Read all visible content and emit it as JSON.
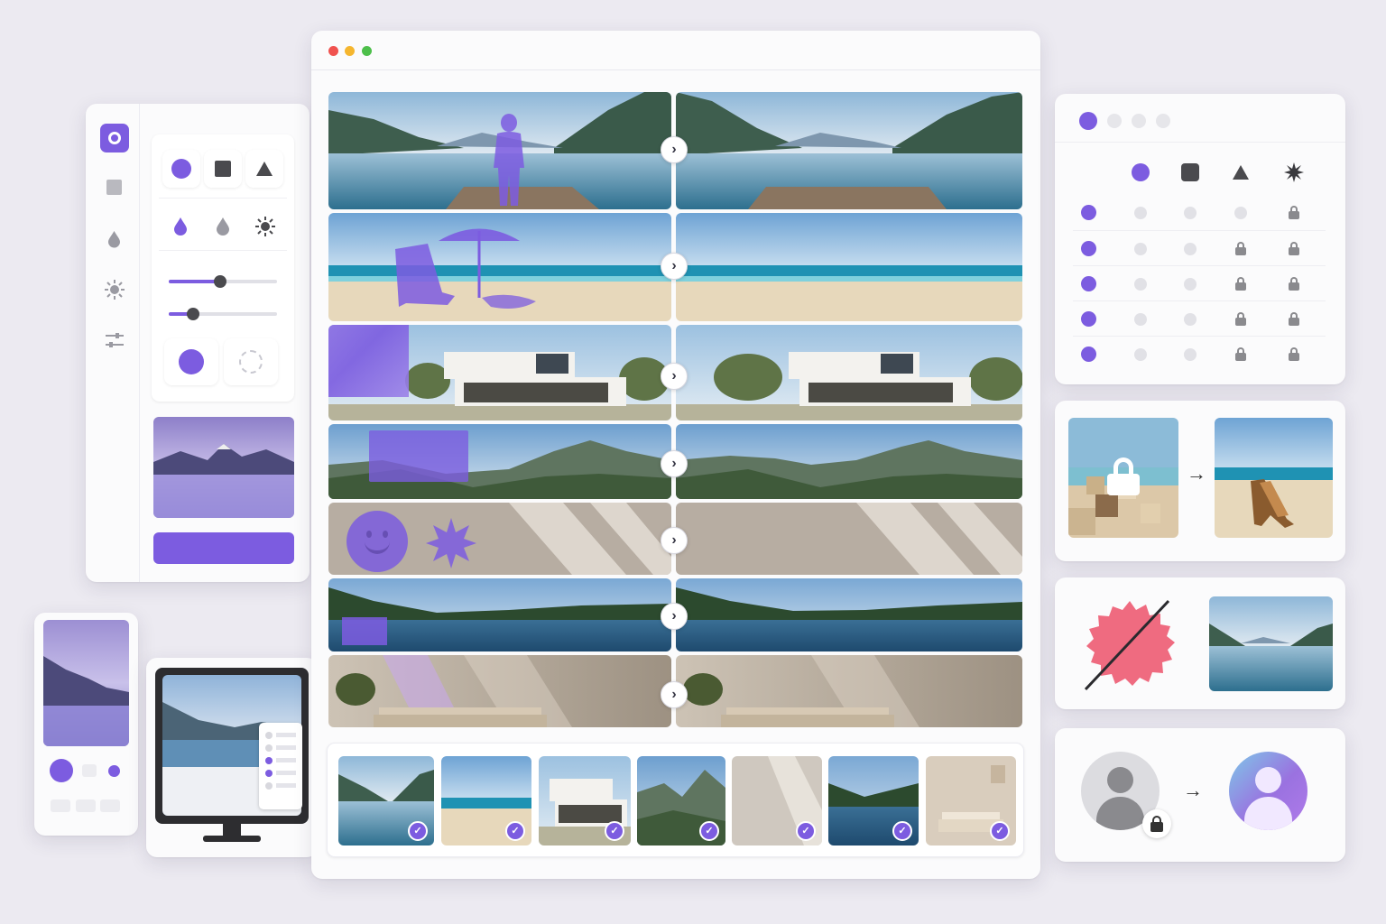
{
  "window": {
    "traffic_lights": [
      "#f0524f",
      "#f5b62f",
      "#4dbf4b"
    ]
  },
  "colors": {
    "accent": "#7c5ce0",
    "accent_light": "#a690f0",
    "coral": "#ef6b80",
    "gray": "#8a8a8a"
  },
  "tools": {
    "left_rail_icons": [
      "square-ring-icon",
      "square-icon",
      "drop-icon",
      "sun-icon",
      "sliders-icon"
    ],
    "shape_icons": [
      "circle-icon",
      "square-icon",
      "triangle-icon"
    ],
    "effect_icons": [
      "drop-icon",
      "drop-icon",
      "sun-icon"
    ],
    "sliders": [
      0.47,
      0.2
    ]
  },
  "comparisons": [
    {
      "scene": "lake-dock",
      "overlay": "person-silhouette"
    },
    {
      "scene": "beach",
      "overlay": "beach-chair-umbrella"
    },
    {
      "scene": "modern-house",
      "overlay": "pixelated-block"
    },
    {
      "scene": "mountain-valley",
      "overlay": "rectangle"
    },
    {
      "scene": "wall-shadows",
      "overlay": "smiley-sun-stickers"
    },
    {
      "scene": "forest-lake",
      "overlay": "small-rectangle"
    },
    {
      "scene": "living-room",
      "overlay": "light-rays"
    }
  ],
  "thumbnails": [
    "lake",
    "beach",
    "house",
    "mountains",
    "wall",
    "forest-lake",
    "living-room"
  ],
  "permissions": {
    "header_icons": [
      "circle-icon",
      "square-icon",
      "triangle-icon",
      "sun-icon"
    ],
    "rows": [
      [
        0,
        0,
        0,
        1
      ],
      [
        0,
        0,
        1,
        1
      ],
      [
        0,
        0,
        1,
        1
      ],
      [
        0,
        0,
        1,
        1
      ],
      [
        0,
        0,
        1,
        1
      ]
    ]
  }
}
